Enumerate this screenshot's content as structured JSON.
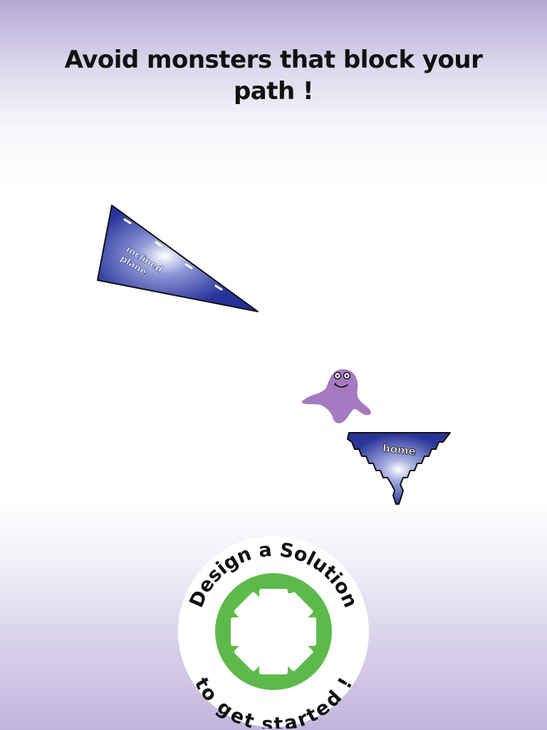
{
  "header": {
    "title": "Avoid monsters that block your path !"
  },
  "pieces": {
    "incline": {
      "label_line1": "inclined",
      "label_line2": "plane",
      "color": "#2d3a9e"
    },
    "home": {
      "label": "home",
      "color": "#2d3a9e"
    }
  },
  "monster": {
    "color": "#a57ac0"
  },
  "start_button": {
    "top_text": "Design a Solution",
    "bottom_text": "to get started !",
    "gear_color": "#5dba4a"
  }
}
